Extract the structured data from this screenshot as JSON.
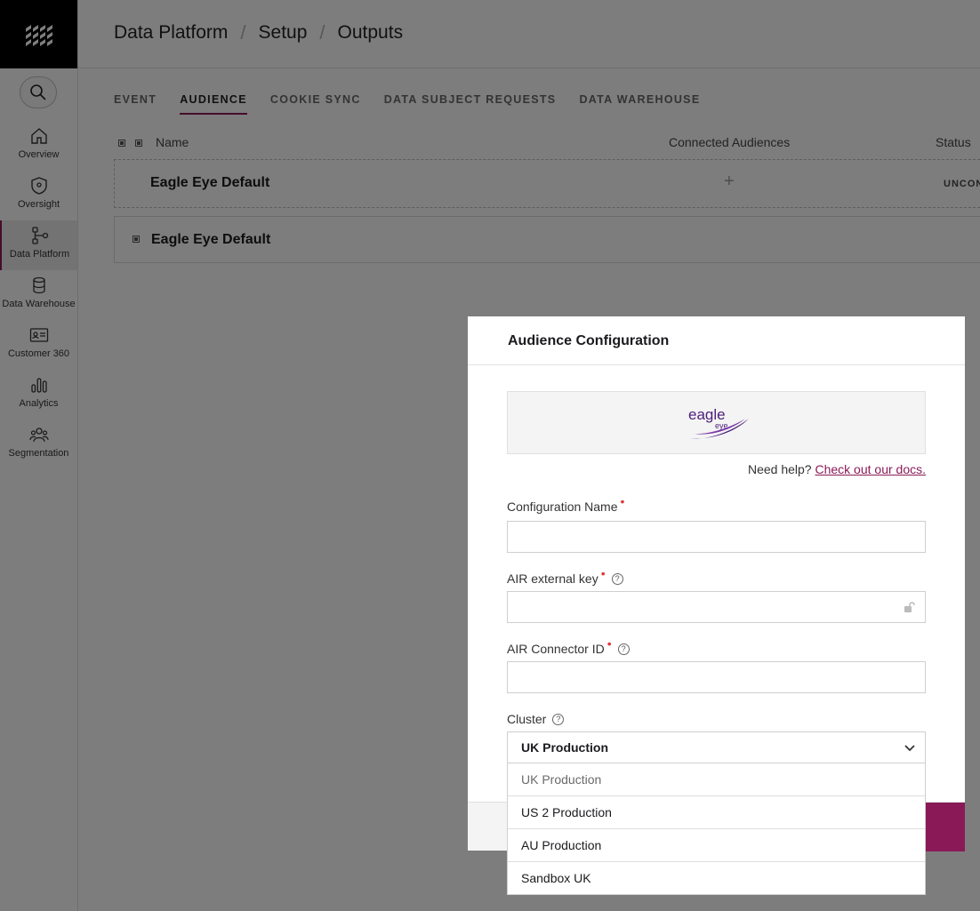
{
  "sidebar": {
    "items": [
      {
        "label": "Overview",
        "icon": "home-icon"
      },
      {
        "label": "Oversight",
        "icon": "shield-pin-icon"
      },
      {
        "label": "Data Platform",
        "icon": "data-flow-icon"
      },
      {
        "label": "Data Warehouse",
        "icon": "database-icon"
      },
      {
        "label": "Customer 360",
        "icon": "id-card-icon"
      },
      {
        "label": "Analytics",
        "icon": "bar-chart-icon"
      },
      {
        "label": "Segmentation",
        "icon": "people-icon"
      }
    ],
    "active": "Data Platform"
  },
  "header": {
    "breadcrumbs": [
      "Data Platform",
      "Setup",
      "Outputs"
    ],
    "separator": "/"
  },
  "tabs": [
    "EVENT",
    "AUDIENCE",
    "COOKIE SYNC",
    "DATA SUBJECT REQUESTS",
    "DATA WAREHOUSE"
  ],
  "active_tab": "AUDIENCE",
  "table": {
    "columns": {
      "name": "Name",
      "connected": "Connected Audiences",
      "status": "Status"
    },
    "rows": [
      {
        "name": "Eagle Eye Default",
        "connected": "+",
        "status": "UNCON"
      },
      {
        "name": "Eagle Eye Default"
      }
    ]
  },
  "modal": {
    "title": "Audience Configuration",
    "logo_text": "eagle",
    "logo_sub": "eye",
    "help_prefix": "Need help?",
    "help_link": "Check out our docs.",
    "fields": {
      "config_name": {
        "label": "Configuration Name",
        "required_mark": "•",
        "value": ""
      },
      "air_key": {
        "label": "AIR external key",
        "required_mark": "•",
        "help": "?",
        "value": ""
      },
      "connector_id": {
        "label": "AIR Connector ID",
        "required_mark": "•",
        "help": "?",
        "value": ""
      },
      "cluster": {
        "label": "Cluster",
        "help": "?",
        "value": "UK Production"
      }
    },
    "cluster_options": [
      "UK Production",
      "US 2 Production",
      "AU Production",
      "Sandbox UK"
    ]
  },
  "colors": {
    "accent": "#8a1a57",
    "required": "#e03a3a"
  }
}
